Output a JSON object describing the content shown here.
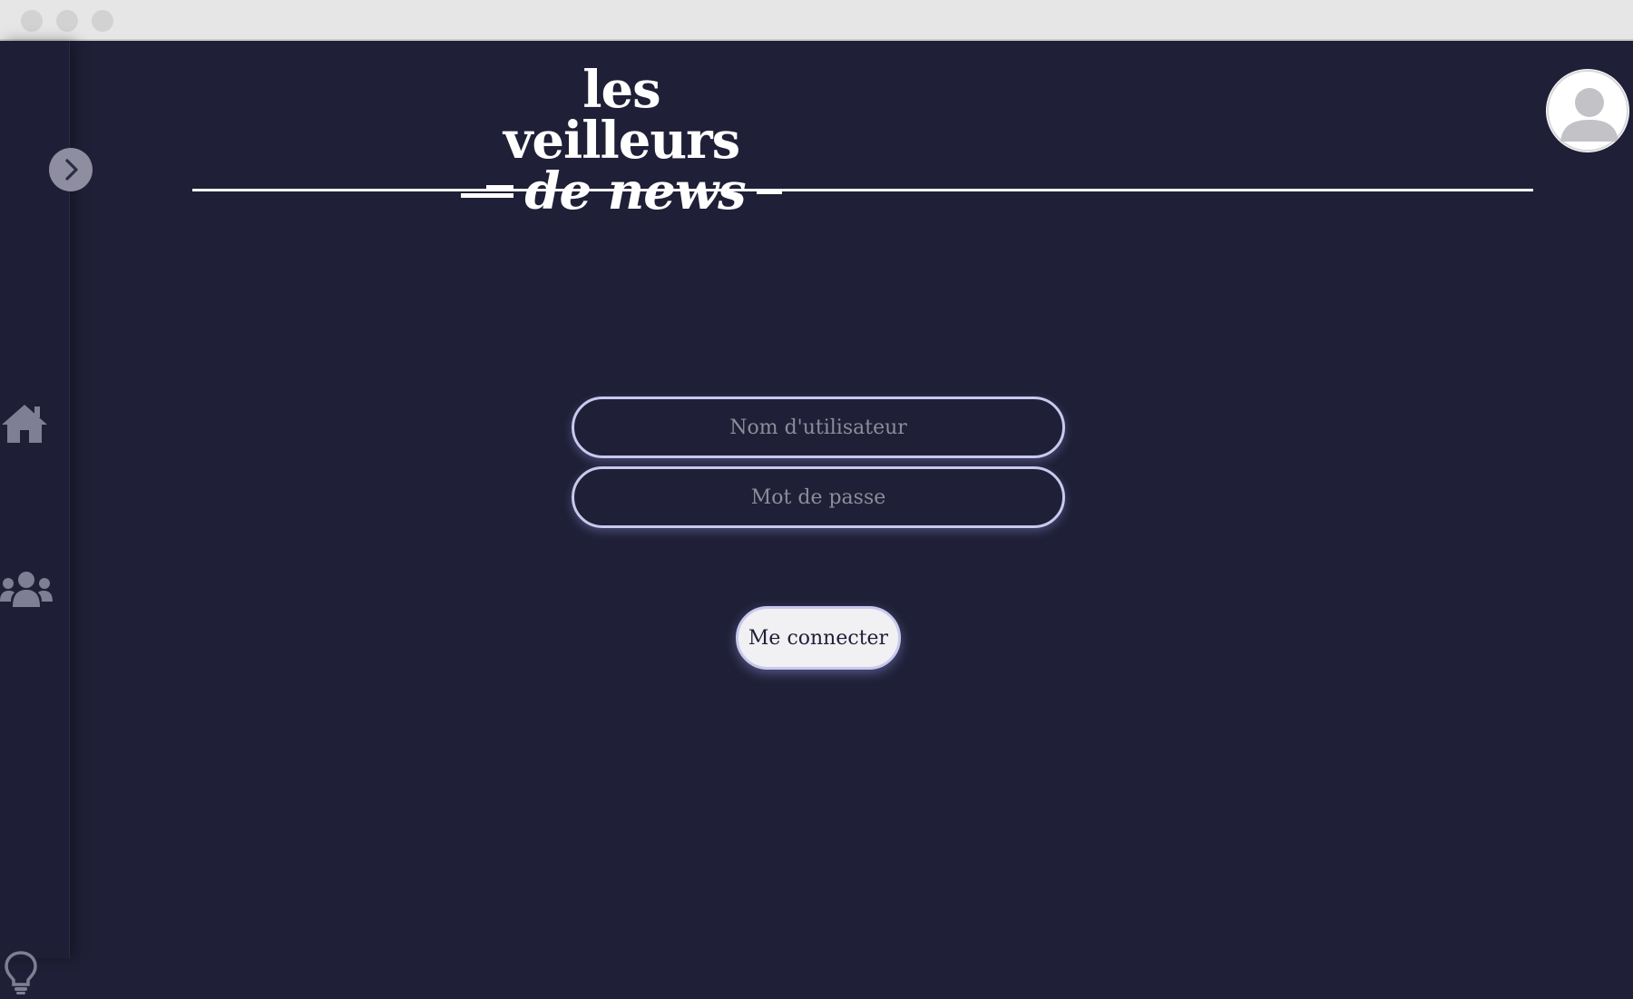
{
  "window": {
    "controls": [
      "close",
      "minimize",
      "maximize"
    ]
  },
  "brand": {
    "line1": "les veilleurs",
    "line2": "de news"
  },
  "sidebar": {
    "items": [
      {
        "icon": "chevron-right-icon"
      },
      {
        "icon": "home-icon"
      },
      {
        "icon": "users-icon"
      },
      {
        "icon": "lightbulb-icon"
      }
    ]
  },
  "login": {
    "username_placeholder": "Nom d'utilisateur",
    "password_placeholder": "Mot de passe",
    "submit_label": "Me connecter"
  },
  "colors": {
    "background": "#1f2037",
    "field_border": "#c9c9ee",
    "button_bg": "#f1f1f4",
    "icon_gray": "#8e8ea0"
  }
}
